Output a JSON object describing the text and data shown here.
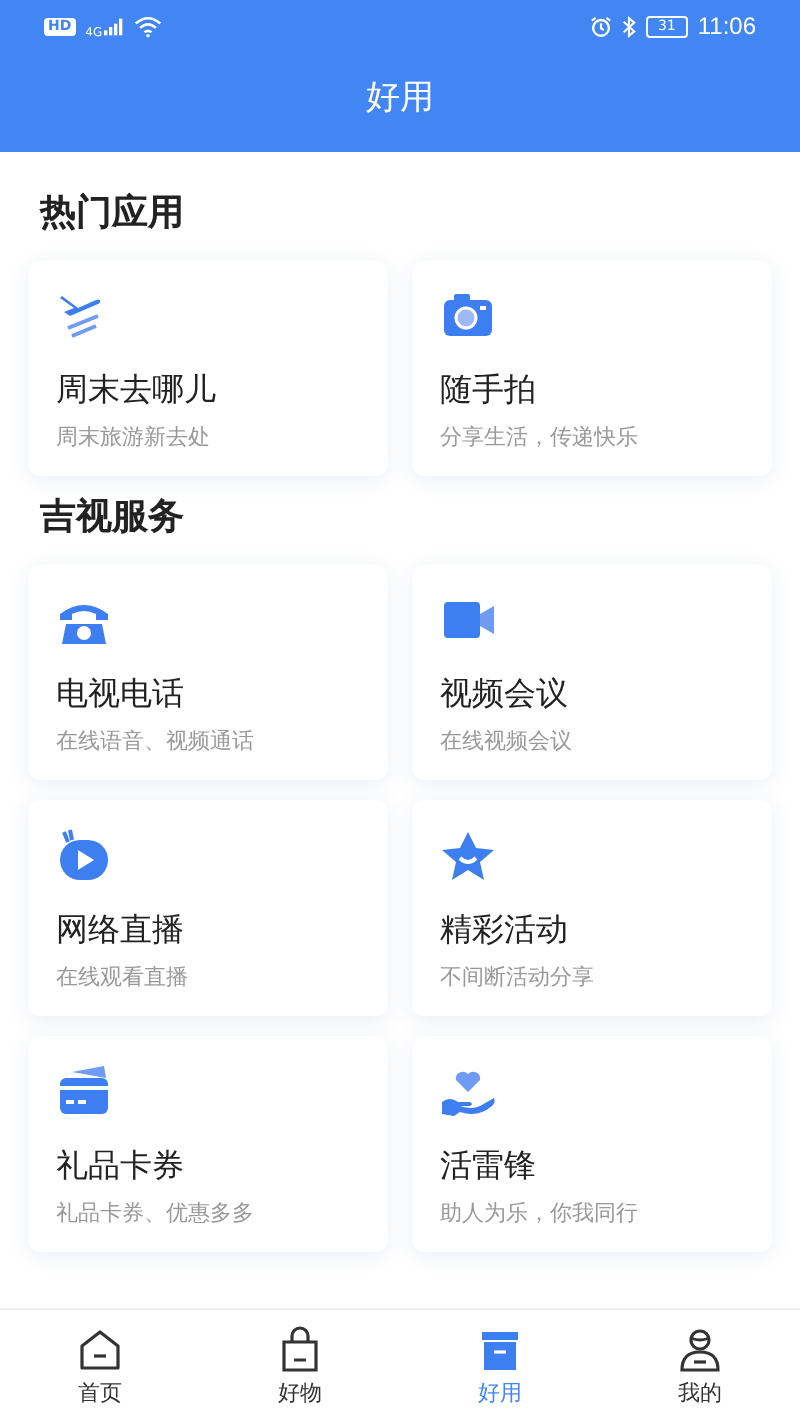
{
  "status_bar": {
    "hd": "HD",
    "network": "4G",
    "battery": "31",
    "time": "11:06"
  },
  "header": {
    "title": "好用"
  },
  "sections": [
    {
      "title": "热门应用",
      "cards": [
        {
          "title": "周末去哪儿",
          "subtitle": "周末旅游新去处"
        },
        {
          "title": "随手拍",
          "subtitle": "分享生活，传递快乐"
        }
      ]
    },
    {
      "title": "吉视服务",
      "cards": [
        {
          "title": "电视电话",
          "subtitle": "在线语音、视频通话"
        },
        {
          "title": "视频会议",
          "subtitle": "在线视频会议"
        },
        {
          "title": "网络直播",
          "subtitle": "在线观看直播"
        },
        {
          "title": "精彩活动",
          "subtitle": "不间断活动分享"
        },
        {
          "title": "礼品卡券",
          "subtitle": "礼品卡券、优惠多多"
        },
        {
          "title": "活雷锋",
          "subtitle": "助人为乐，你我同行"
        }
      ]
    }
  ],
  "tab_bar": [
    {
      "label": "首页",
      "selected": false
    },
    {
      "label": "好物",
      "selected": false
    },
    {
      "label": "好用",
      "selected": true
    },
    {
      "label": "我的",
      "selected": false
    }
  ]
}
